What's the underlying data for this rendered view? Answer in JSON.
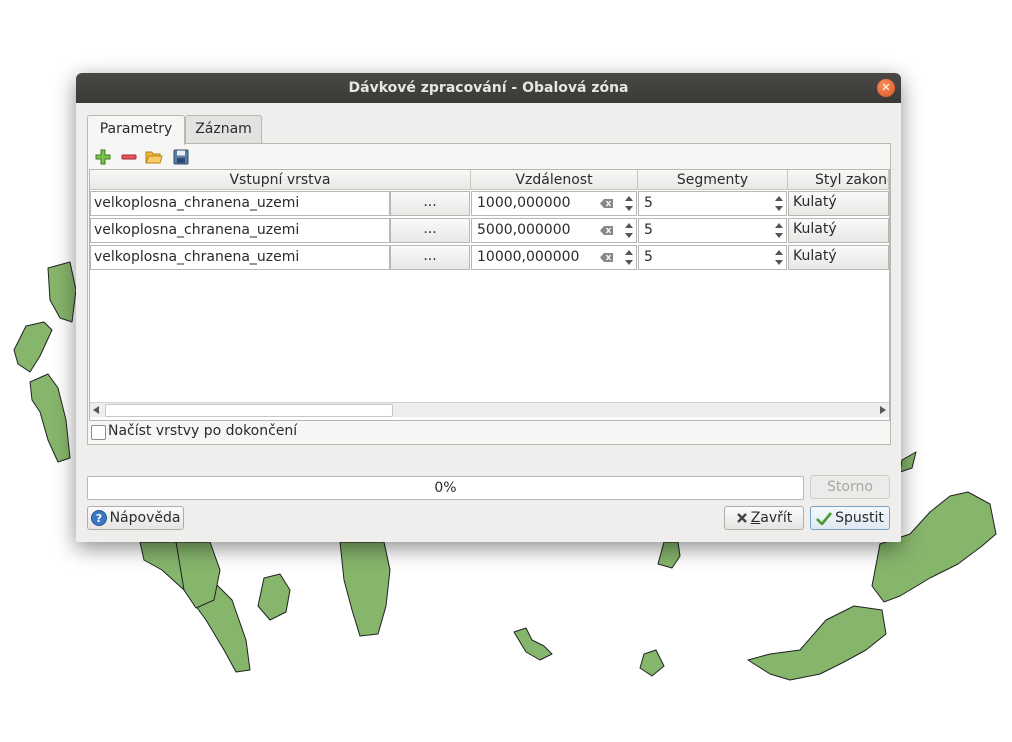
{
  "window": {
    "title": "Dávkové zpracování - Obalová zóna"
  },
  "tabs": [
    {
      "label": "Parametry",
      "active": true
    },
    {
      "label": "Záznam",
      "active": false
    }
  ],
  "toolbar": {
    "icons": [
      "add-row-icon",
      "remove-row-icon",
      "open-folder-icon",
      "save-icon"
    ]
  },
  "table": {
    "headers": [
      "Vstupní vrstva",
      "Vzdálenost",
      "Segmenty",
      "Styl zakončení"
    ],
    "rows": [
      {
        "layer": "velkoplosna_chranena_uzemi",
        "browse": "...",
        "distance": "1000,000000",
        "segments": "5",
        "style": "Kulatý"
      },
      {
        "layer": "velkoplosna_chranena_uzemi",
        "browse": "...",
        "distance": "5000,000000",
        "segments": "5",
        "style": "Kulatý"
      },
      {
        "layer": "velkoplosna_chranena_uzemi",
        "browse": "...",
        "distance": "10000,000000",
        "segments": "5",
        "style": "Kulatý"
      }
    ]
  },
  "load_layers": {
    "label": "Načíst vrstvy po dokončení",
    "checked": false
  },
  "progress": {
    "text": "0%",
    "value": 0
  },
  "buttons": {
    "cancel": "Storno",
    "help": "Nápověda",
    "close_first": "Z",
    "close_rest": "avřít",
    "run": "Spustit"
  },
  "colors": {
    "map_fill": "#86b56c",
    "titlebar": "#3e3d3a",
    "close_button": "#e8622a"
  }
}
